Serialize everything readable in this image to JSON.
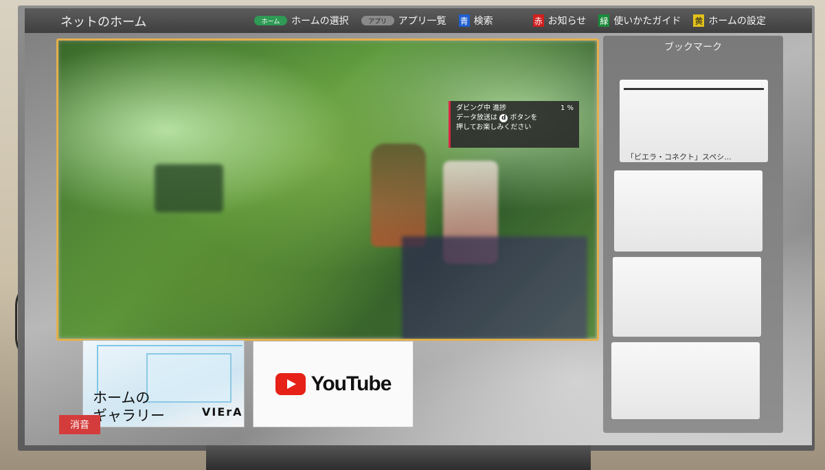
{
  "header": {
    "title": "ネットのホーム",
    "menu": [
      {
        "badge": "ホーム",
        "label": "ホームの選択"
      },
      {
        "badge": "アプリ",
        "label": "アプリ一覧"
      },
      {
        "key": "青",
        "label": "検索",
        "color": "#1f5fd0"
      },
      {
        "key": "赤",
        "label": "お知らせ",
        "color": "#d11f1f"
      },
      {
        "key": "緑",
        "label": "使いかたガイド",
        "color": "#1c8b3b"
      },
      {
        "key": "黄",
        "label": "ホームの設定",
        "color": "#e3c21a"
      }
    ]
  },
  "video": {
    "overlay": {
      "status": "ダビング中",
      "progress_label": "進捗",
      "progress_value": "1 %",
      "line2a": "データ放送は",
      "d_button": "d",
      "line2b": "ボタンを",
      "line3": "押してお楽しみください"
    }
  },
  "tiles": {
    "gallery": {
      "text": "ホームの\nギャラリー",
      "brand": "VIErA"
    },
    "youtube": {
      "text": "YouTube"
    }
  },
  "mute": "消音",
  "bookmarks": {
    "title": "ブックマーク",
    "items": [
      {
        "caption": "「ビエラ・コネクト」スペシ..."
      }
    ]
  },
  "colors": {
    "focus": "#e4b04a",
    "mute": "#d43b3b"
  }
}
